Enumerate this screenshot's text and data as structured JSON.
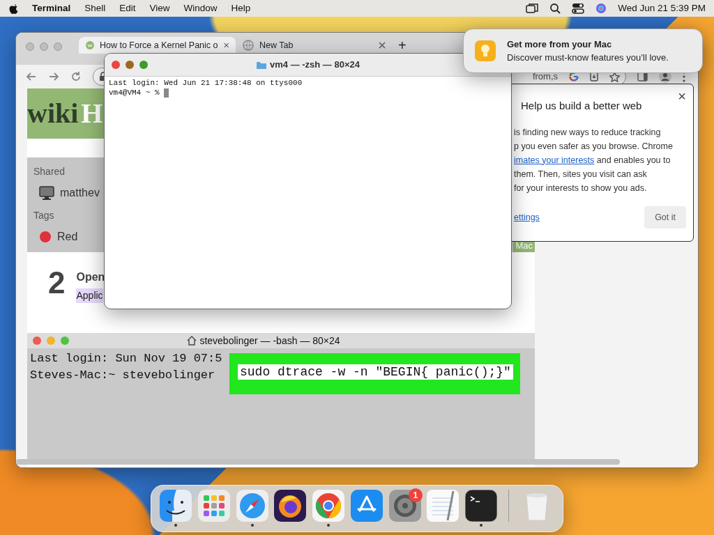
{
  "menu_bar": {
    "app": "Terminal",
    "menus": [
      "Shell",
      "Edit",
      "View",
      "Window",
      "Help"
    ],
    "clock": "Wed Jun 21  5:39 PM"
  },
  "browser": {
    "tabs": [
      {
        "label": "How to Force a Kernel Panic o",
        "selected": true
      },
      {
        "label": "New Tab",
        "selected": false
      }
    ],
    "new_tab": "+",
    "address": "from,s",
    "page": {
      "logo": [
        "wiki",
        "H"
      ],
      "sidebar_sections": [
        {
          "heading": "Shared",
          "items": [
            {
              "kind": "device",
              "label": "matthev"
            }
          ]
        },
        {
          "heading": "Tags",
          "items": [
            {
              "kind": "tag",
              "label": "Red",
              "color": "#e0313b"
            }
          ]
        }
      ],
      "tag": "Mac",
      "step": {
        "number": "2",
        "title": "Open",
        "highlight": "Applic"
      },
      "screenshot": {
        "title": "stevebolinger — -bash — 80×24",
        "lines": [
          "Last login: Sun Nov 19 07:5",
          "Steves-Mac:~ stevebolinger"
        ],
        "highlight": "sudo dtrace -w -n \"BEGIN{ panic();}\""
      }
    },
    "popup": {
      "title": "Help us build a better web",
      "close": "×",
      "paragraph": [
        {
          "text": "is finding new ways to reduce tracking"
        },
        {
          "text": "p you even safer as you browse. Chrome"
        },
        {
          "link": "imates your interests",
          "text": " and enables you to"
        },
        {
          "text": "them. Then, sites you visit can ask"
        },
        {
          "text": "for your interests to show you ads."
        }
      ],
      "link": "ettings",
      "button": "Got it"
    }
  },
  "terminal": {
    "title": "vm4 — -zsh — 80×24",
    "lines": [
      "Last login: Wed Jun 21 17:38:48 on ttys000",
      "vm4@VM4 ~ %"
    ]
  },
  "notification": {
    "title": "Get more from your Mac",
    "text": "Discover must-know features you’ll love."
  },
  "dock": [
    {
      "kind": "finder",
      "running": true
    },
    {
      "kind": "launchpad",
      "running": false
    },
    {
      "kind": "safari",
      "running": true
    },
    {
      "kind": "firefox",
      "running": false
    },
    {
      "kind": "chrome",
      "running": true
    },
    {
      "kind": "appstore",
      "running": false
    },
    {
      "kind": "settings",
      "running": false,
      "badge": "1"
    },
    {
      "kind": "textedit",
      "running": false
    },
    {
      "kind": "terminal",
      "running": true
    },
    {
      "kind": "trash",
      "running": false
    }
  ]
}
